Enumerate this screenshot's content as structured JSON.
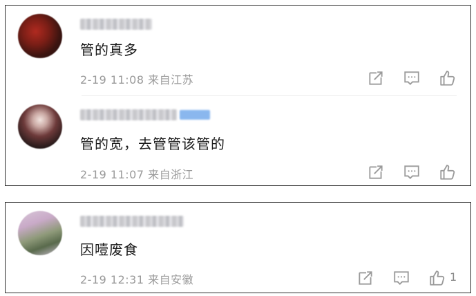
{
  "comments": [
    {
      "content": "管的真多",
      "time": "2-19 11:08",
      "location": "来自江苏",
      "likes": ""
    },
    {
      "content": "管的宽，去管管该管的",
      "time": "2-19 11:07",
      "location": "来自浙江",
      "likes": ""
    },
    {
      "content": "因噎废食",
      "time": "2-19 12:31",
      "location": "来自安徽",
      "likes": "1"
    }
  ],
  "icons": {
    "share": "share-icon",
    "reply": "comment-icon",
    "like": "thumbs-up-icon"
  }
}
